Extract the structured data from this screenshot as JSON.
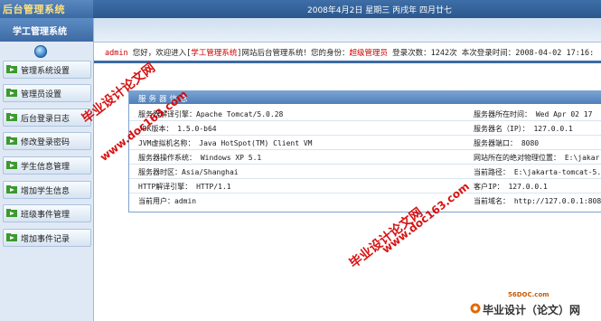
{
  "header": {
    "logo_text": "后台管理系统",
    "date_text": "2008年4月2日 星期三 丙戌年 四月廿七"
  },
  "sidebar": {
    "title": "学工管理系统",
    "items": [
      {
        "label": "管理系统设置",
        "icon": "folder-arrow-icon"
      },
      {
        "label": "管理员设置",
        "icon": "folder-arrow-icon"
      },
      {
        "label": "后台登录日志",
        "icon": "folder-arrow-icon"
      },
      {
        "label": "修改登录密码",
        "icon": "folder-arrow-icon"
      },
      {
        "label": "学生信息管理",
        "icon": "folder-arrow-icon"
      },
      {
        "label": "增加学生信息",
        "icon": "folder-arrow-icon"
      },
      {
        "label": "班级事件管理",
        "icon": "folder-arrow-icon"
      },
      {
        "label": "增加事件记录",
        "icon": "folder-arrow-icon"
      }
    ]
  },
  "welcome": {
    "user": "admin",
    "text1": " 您好，欢迎进入[",
    "system": "学工管理系统",
    "text2": "]网站后台管理系统！您的身份：",
    "role": "超级管理员",
    "text3": "  登录次数：1242次  本次登录时间：2008-04-02 17:16:"
  },
  "server_panel": {
    "title": "服务器信息",
    "rows": [
      {
        "left": "服务器解译引擎：Apache Tomcat/5.0.28",
        "right": "服务器所在时间： Wed Apr 02 17"
      },
      {
        "left": "JDK版本：  1.5.0-b64",
        "right": "服务器名（IP）： 127.0.0.1"
      },
      {
        "left": "JVM虚拟机名称： Java HotSpot(TM) Client VM",
        "right": "服务器端口： 8080"
      },
      {
        "left": "服务器操作系统： Windows XP 5.1",
        "right": "网站所在的绝对物理位置： E:\\jakar"
      },
      {
        "left": "服务器时区：Asia/Shanghai",
        "right": "当前路径： E:\\jakarta-tomcat-5.0"
      },
      {
        "left": "HTTP解译引擎： HTTP/1.1",
        "right": "客户IP： 127.0.0.1"
      },
      {
        "left": "当前用户：admin",
        "right": "当前域名：  http://127.0.0.1:808"
      }
    ]
  },
  "watermarks": {
    "w1": "毕业设计论文网",
    "w2": "www.doc163.com",
    "w3": "毕业设计论文网",
    "w4": "www.doc163.com"
  },
  "brand": {
    "url": "56DOC.com",
    "name": "毕业设计（论文）网"
  },
  "colors": {
    "header_blue": "#2b568c",
    "sidebar_bg": "#dfe9f5",
    "accent_red": "#cc0000",
    "watermark_red": "#d40000"
  }
}
